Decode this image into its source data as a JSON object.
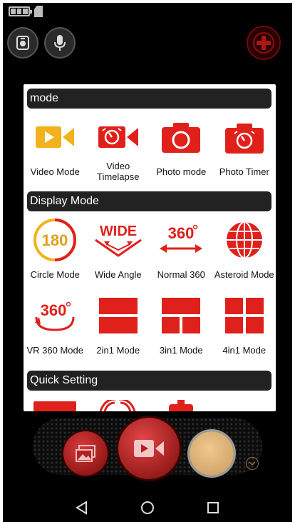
{
  "status": {
    "battery_icon": "battery-icon",
    "sd_icon": "sdcard-icon"
  },
  "top": {
    "switch_icon": "camera-switch-icon",
    "mic_icon": "microphone-icon",
    "add_icon": "plus-icon"
  },
  "sections": {
    "mode": {
      "title": "mode",
      "items": [
        {
          "label": "Video Mode",
          "icon": "video-camera-icon"
        },
        {
          "label": "Video Timelapse",
          "icon": "video-timelapse-icon"
        },
        {
          "label": "Photo mode",
          "icon": "photo-camera-icon"
        },
        {
          "label": "Photo Timer",
          "icon": "photo-timer-icon"
        }
      ]
    },
    "display": {
      "title": "Display Mode",
      "items": [
        {
          "label": "Circle Mode",
          "icon": "circle-180-icon"
        },
        {
          "label": "Wide Angle",
          "icon": "wide-angle-icon"
        },
        {
          "label": "Normal 360",
          "icon": "normal-360-icon"
        },
        {
          "label": "Asteroid Mode",
          "icon": "asteroid-globe-icon"
        },
        {
          "label": "VR 360 Mode",
          "icon": "vr-360-icon"
        },
        {
          "label": "2in1 Mode",
          "icon": "two-in-one-icon"
        },
        {
          "label": "3in1 Mode",
          "icon": "three-in-one-icon"
        },
        {
          "label": "4in1 Mode",
          "icon": "four-in-one-icon"
        }
      ]
    },
    "quick": {
      "title": "Quick Setting"
    }
  },
  "icon_text": {
    "c180": "180",
    "wide": "WIDE",
    "n360": "360",
    "vr360": "360"
  },
  "bottom": {
    "gallery_icon": "gallery-icon",
    "record_icon": "record-video-icon",
    "thumb": "last-capture-thumbnail"
  },
  "nav": {
    "back": "back-icon",
    "home": "home-icon",
    "recents": "recents-icon"
  },
  "colors": {
    "accent_red": "#e0201b",
    "yellow": "#f2b21b",
    "header_bg": "#222222"
  }
}
